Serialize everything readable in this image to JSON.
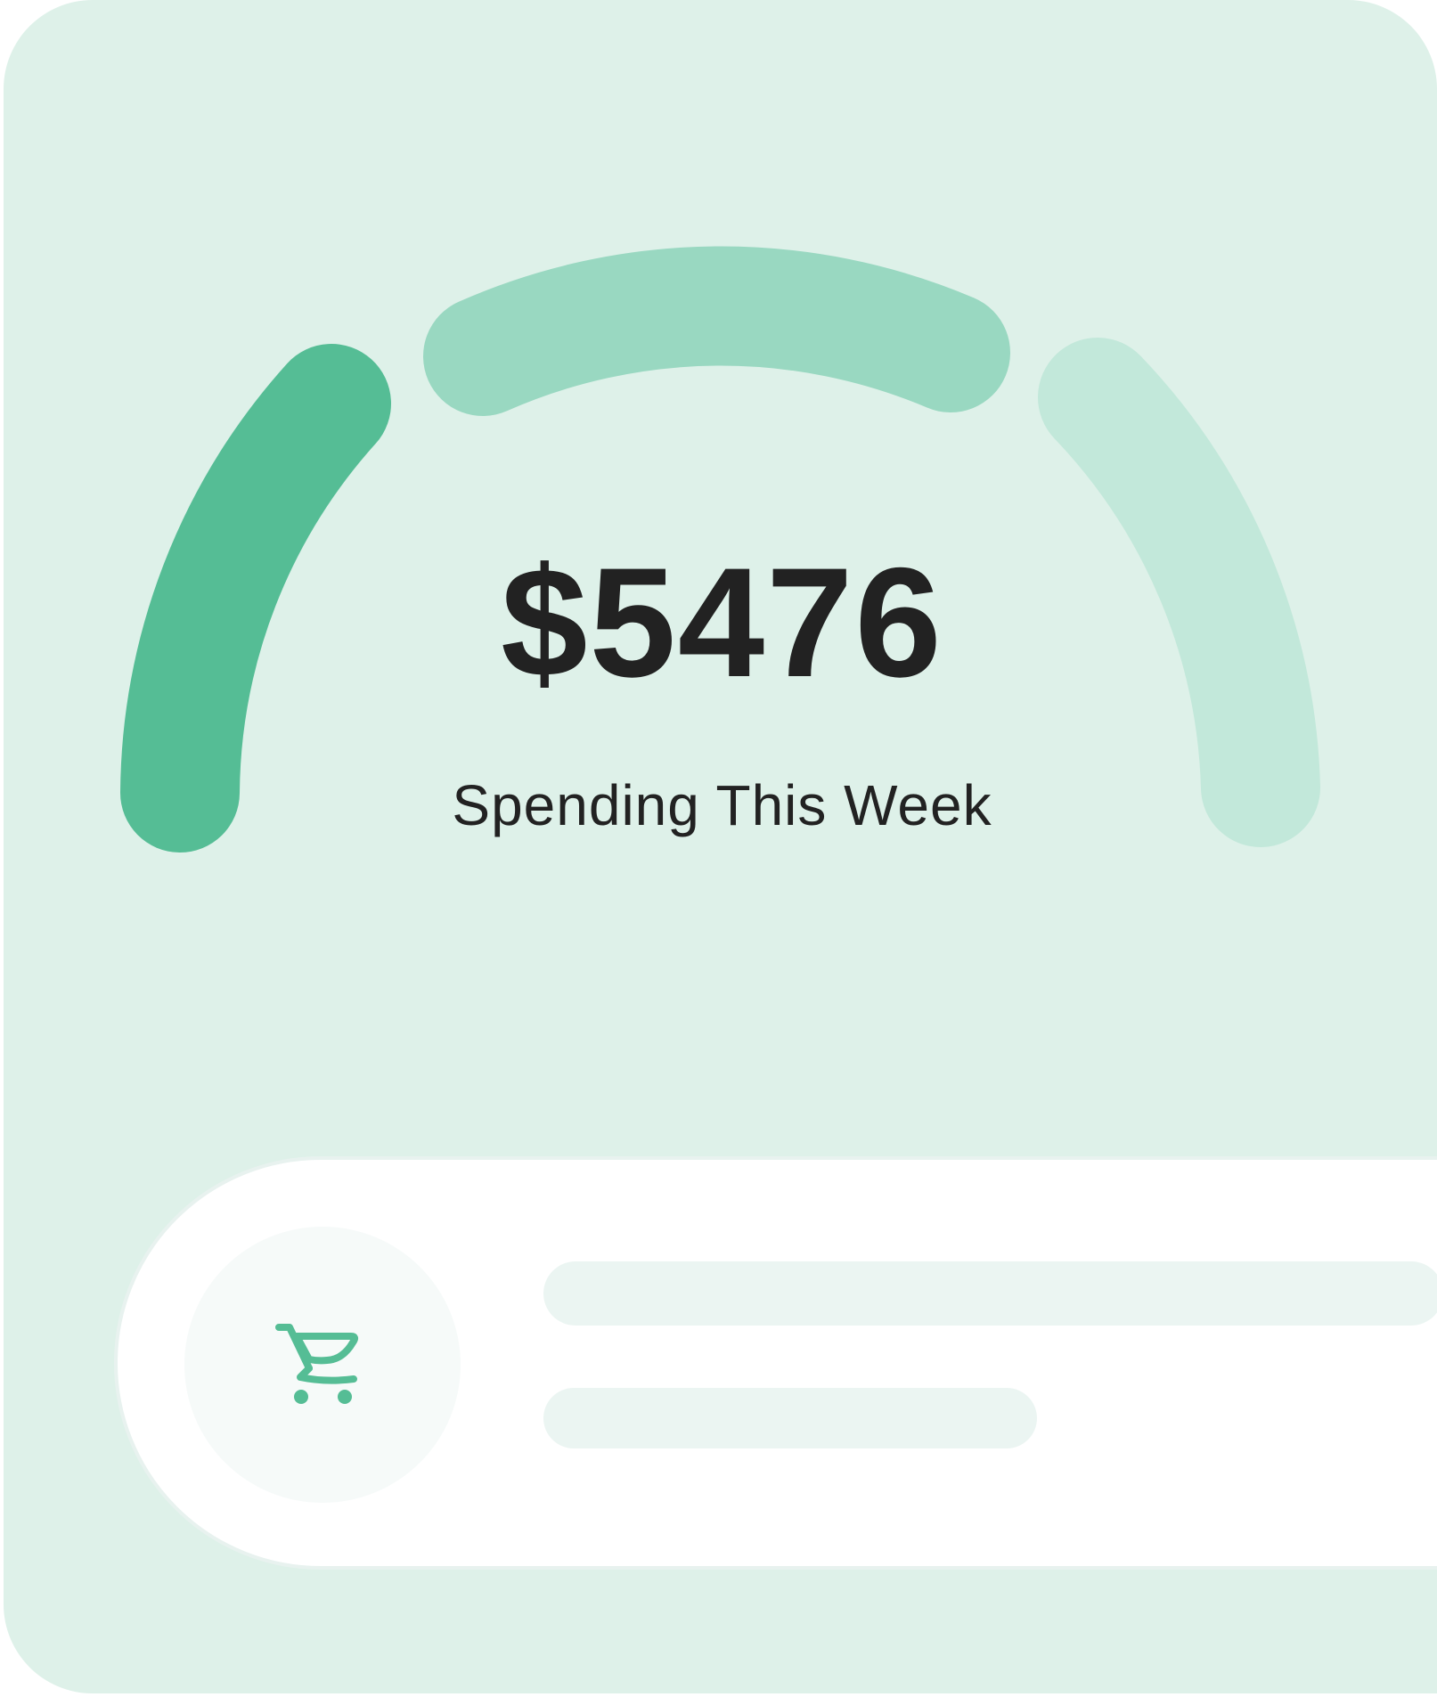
{
  "widget": {
    "amount": "$5476",
    "label": "Spending This Week"
  },
  "gauge": {
    "segments": [
      {
        "name": "left",
        "color": "#55bd95"
      },
      {
        "name": "top",
        "color": "#99d8c1"
      },
      {
        "name": "right",
        "color": "#c2e8da"
      }
    ]
  },
  "list_item": {
    "icon": "shopping-cart-icon",
    "icon_color": "#55bd95"
  },
  "colors": {
    "background": "#def1e9",
    "text": "#222222",
    "card": "#ffffff",
    "placeholder": "#ebf5f2"
  }
}
